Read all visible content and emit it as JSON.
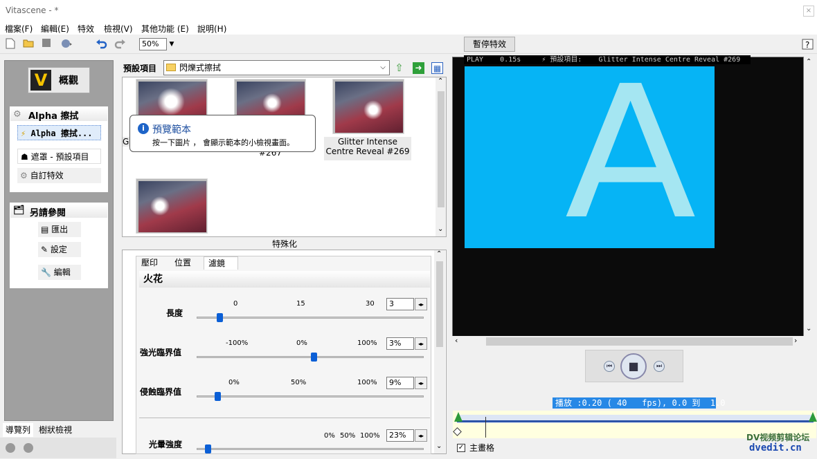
{
  "window": {
    "title": "Vitascene - *",
    "close": "×"
  },
  "menu": [
    "檔案(F)",
    "編輯(E)",
    "特效",
    "檢視(V)",
    "其他功能 (E)",
    "說明(H)"
  ],
  "toolbar": {
    "icons": [
      "new-file-icon",
      "open-folder-icon",
      "save-icon",
      "render-icon",
      "undo-icon",
      "redo-icon"
    ],
    "zoom": "50%",
    "pause_label": "暫停特效",
    "help": "?"
  },
  "left": {
    "logo_letter": "V",
    "logo_label": "概觀",
    "alpha_section": "Alpha 擦拭",
    "alpha_items": [
      "Alpha 擦拭...",
      "遮罩 - 預設項目",
      "自訂特效"
    ],
    "other_section": "另請參閱",
    "other_items": [
      "匯出",
      "設定",
      "編輯"
    ],
    "bottom_tabs": [
      "導覽列",
      "樹狀檢視"
    ]
  },
  "preset": {
    "label": "預設項目",
    "combo": "閃爍式擦拭",
    "captions": [
      "G",
      "#267",
      "Glitter Intense Centre Reveal #269"
    ],
    "tooltip_title": "預覽範本",
    "tooltip_text": "按一下圖片 ， 會顯示範本的小檢視畫面。",
    "footer": "特殊化"
  },
  "params": {
    "tabs": [
      "壓印",
      "位置",
      "濾鏡"
    ],
    "section": "火花",
    "rows": [
      {
        "label": "長度",
        "ticks": [
          "0",
          "15",
          "30"
        ],
        "value": "3",
        "level": 0.1
      },
      {
        "label": "強光臨界值",
        "ticks": [
          "-100%",
          "0%",
          "100%"
        ],
        "value": "3%",
        "level": 0.515
      },
      {
        "label": "侵蝕臨界值",
        "ticks": [
          "0%",
          "50%",
          "100%"
        ],
        "value": "9%",
        "level": 0.09
      },
      {
        "label": "光暈強度",
        "ticks": [
          "0%",
          "50%",
          "100%"
        ],
        "value": "23%",
        "level": 0.05
      }
    ]
  },
  "preview": {
    "overlay": "PLAY    0.15s     ⚡ 預設項目:    Glitter Intense Centre Reveal #269",
    "letter": "A",
    "bg_color": "#06b4f5",
    "letter_color": "#a5e6f2"
  },
  "transport": {
    "prev": "⏮",
    "stop": "■",
    "next": "⏭"
  },
  "status": "播放 :0.20 ( 40   fps), 0.0 到  1.0",
  "timeline": {
    "main_track": "主畫格",
    "checked": "✓"
  },
  "watermark": {
    "line1": "DV视频剪辑论坛",
    "line2": "dvedit.cn"
  }
}
